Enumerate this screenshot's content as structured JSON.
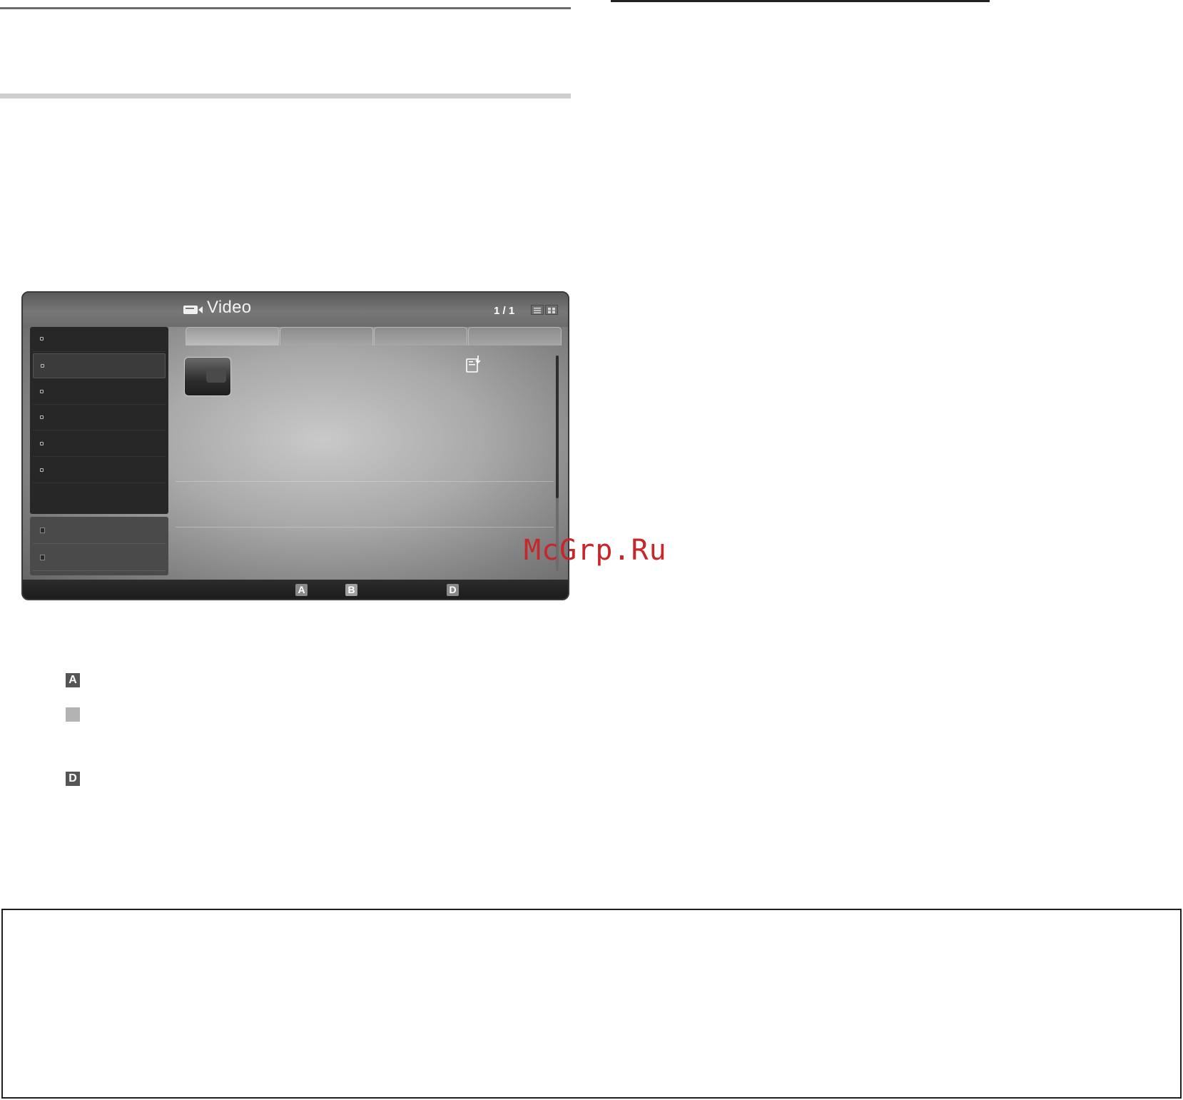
{
  "screen": {
    "title": "Video",
    "icon": "video-camera-icon",
    "page_indicator": "1 / 1"
  },
  "color_keys": {
    "a": "A",
    "b": "B",
    "d": "D"
  },
  "legend": {
    "a": "A",
    "d": "D"
  },
  "watermark": "McGrp.Ru",
  "colors": {
    "watermark": "#c8262b",
    "key_a": "#8a8a8a",
    "key_b": "#9f9f9f",
    "key_d": "#8a8a8a"
  }
}
